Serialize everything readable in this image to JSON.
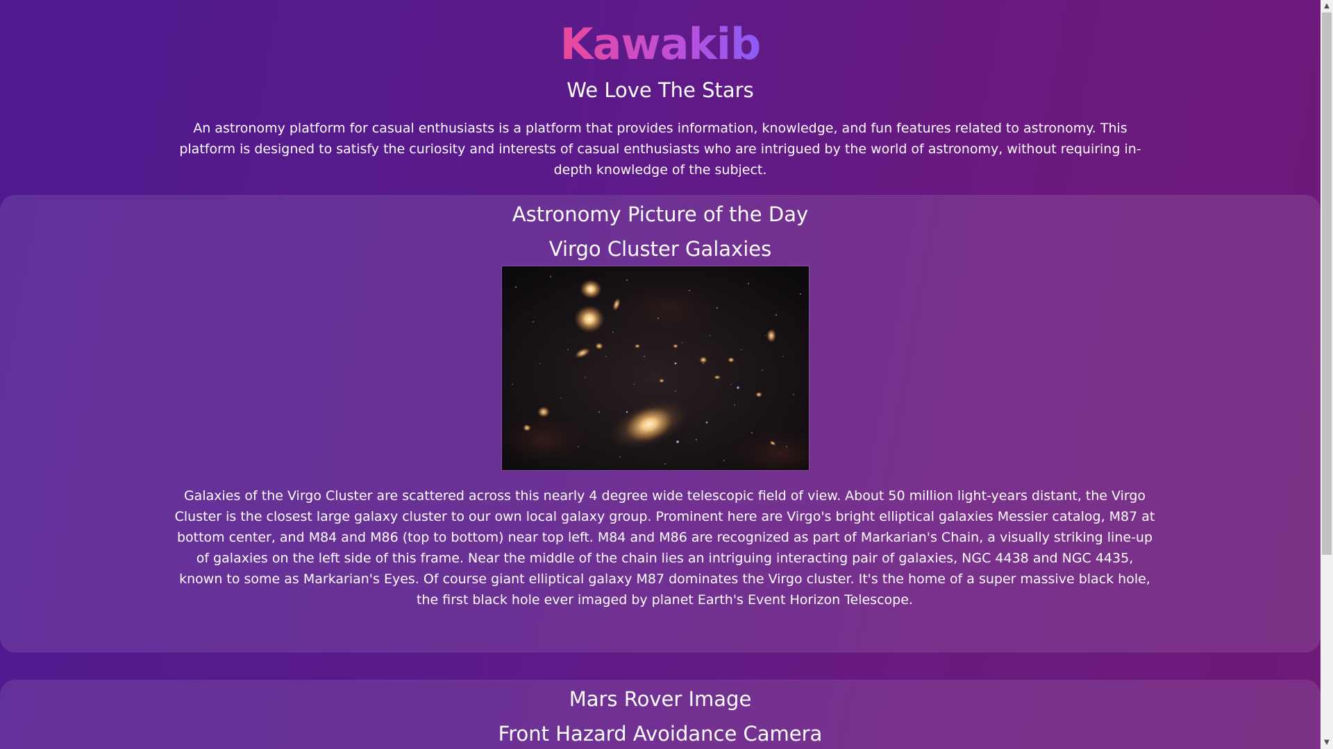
{
  "header": {
    "brand": "Kawakib",
    "tagline": "We Love The Stars",
    "intro": "An astronomy platform for casual enthusiasts is a platform that provides information, knowledge, and fun features related to astronomy. This platform is designed to satisfy the curiosity and interests of casual enthusiasts who are intrigued by the world of astronomy, without requiring in-depth knowledge of the subject."
  },
  "apod": {
    "section_title": "Astronomy Picture of the Day",
    "title": "Virgo Cluster Galaxies",
    "image_alt": "Virgo Cluster Galaxies",
    "explanation": "Galaxies of the Virgo Cluster are scattered across this nearly 4 degree wide telescopic field of view. About 50 million light-years distant, the Virgo Cluster is the closest large galaxy cluster to our own local galaxy group. Prominent here are Virgo's bright elliptical galaxies Messier catalog, M87 at bottom center, and M84 and M86 (top to bottom) near top left. M84 and M86 are recognized as part of Markarian's Chain, a visually striking line-up of galaxies on the left side of this frame. Near the middle of the chain lies an intriguing interacting pair of galaxies, NGC 4438 and NGC 4435, known to some as Markarian's Eyes. Of course giant elliptical galaxy M87 dominates the Virgo cluster. It's the home of a super massive black hole, the first black hole ever imaged by planet Earth's Event Horizon Telescope."
  },
  "mars": {
    "section_title": "Mars Rover Image",
    "camera": "Front Hazard Avoidance Camera"
  },
  "colors": {
    "background_start": "#4f1a8f",
    "background_end": "#6d1a78",
    "brand_gradient_start": "#ec4899",
    "brand_gradient_end": "#8b5cf6",
    "text": "#ffffff"
  },
  "scrollbar": {
    "up_icon": "triangle-up-icon",
    "down_icon": "triangle-down-icon"
  }
}
